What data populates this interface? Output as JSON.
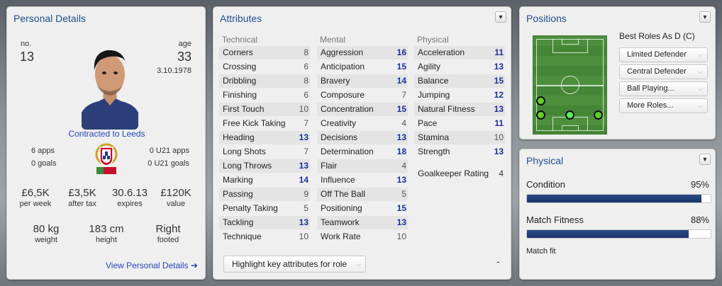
{
  "personal": {
    "title": "Personal Details",
    "no_label": "no.",
    "no_value": "13",
    "age_label": "age",
    "age_value": "33",
    "dob": "3.10.1978",
    "contract": "Contracted to Leeds",
    "apps": "6 apps",
    "goals": "0 goals",
    "u21_apps": "0 U21 apps",
    "u21_goals": "0 U21 goals",
    "stats": [
      {
        "value": "£6,5K",
        "label": "per week"
      },
      {
        "value": "£3,5K",
        "label": "after tax"
      },
      {
        "value": "30.6.13",
        "label": "expires"
      },
      {
        "value": "£120K",
        "label": "value"
      }
    ],
    "body": [
      {
        "value": "80 kg",
        "label": "weight"
      },
      {
        "value": "183 cm",
        "label": "height"
      },
      {
        "value": "Right",
        "label": "footed"
      }
    ],
    "view_link": "View Personal Details ➜"
  },
  "attributes": {
    "title": "Attributes",
    "technical_head": "Technical",
    "mental_head": "Mental",
    "physical_head": "Physical",
    "technical": [
      {
        "name": "Corners",
        "value": "8"
      },
      {
        "name": "Crossing",
        "value": "6"
      },
      {
        "name": "Dribbling",
        "value": "8"
      },
      {
        "name": "Finishing",
        "value": "6"
      },
      {
        "name": "First Touch",
        "value": "10"
      },
      {
        "name": "Free Kick Taking",
        "value": "7"
      },
      {
        "name": "Heading",
        "value": "13"
      },
      {
        "name": "Long Shots",
        "value": "7"
      },
      {
        "name": "Long Throws",
        "value": "13"
      },
      {
        "name": "Marking",
        "value": "14"
      },
      {
        "name": "Passing",
        "value": "9"
      },
      {
        "name": "Penalty Taking",
        "value": "5"
      },
      {
        "name": "Tackling",
        "value": "13"
      },
      {
        "name": "Technique",
        "value": "10"
      }
    ],
    "mental": [
      {
        "name": "Aggression",
        "value": "16"
      },
      {
        "name": "Anticipation",
        "value": "15"
      },
      {
        "name": "Bravery",
        "value": "14"
      },
      {
        "name": "Composure",
        "value": "7"
      },
      {
        "name": "Concentration",
        "value": "15"
      },
      {
        "name": "Creativity",
        "value": "4"
      },
      {
        "name": "Decisions",
        "value": "13"
      },
      {
        "name": "Determination",
        "value": "18"
      },
      {
        "name": "Flair",
        "value": "4"
      },
      {
        "name": "Influence",
        "value": "13"
      },
      {
        "name": "Off The Ball",
        "value": "5"
      },
      {
        "name": "Positioning",
        "value": "15"
      },
      {
        "name": "Teamwork",
        "value": "13"
      },
      {
        "name": "Work Rate",
        "value": "10"
      }
    ],
    "physical": [
      {
        "name": "Acceleration",
        "value": "11"
      },
      {
        "name": "Agility",
        "value": "13"
      },
      {
        "name": "Balance",
        "value": "15"
      },
      {
        "name": "Jumping",
        "value": "12"
      },
      {
        "name": "Natural Fitness",
        "value": "13"
      },
      {
        "name": "Pace",
        "value": "11"
      },
      {
        "name": "Stamina",
        "value": "10"
      },
      {
        "name": "Strength",
        "value": "13"
      }
    ],
    "goalkeeper": {
      "name": "Goalkeeper Rating",
      "value": "4"
    },
    "highlight_button": "Highlight key attributes for role",
    "dash": "-"
  },
  "positions": {
    "title": "Positions",
    "best_roles": "Best Roles As D (C)",
    "roles": [
      "Limited Defender",
      "Central Defender",
      "Ball Playing...",
      "More Roles..."
    ]
  },
  "physical": {
    "title": "Physical",
    "condition_label": "Condition",
    "condition_pct": "95%",
    "condition_value": 95,
    "fitness_label": "Match Fitness",
    "fitness_pct": "88%",
    "fitness_value": 88,
    "status": "Match fit"
  },
  "colors": {
    "title_blue": "#1f4f8c",
    "value_blue": "#1a2f9c",
    "value_grey": "#555555",
    "bar_fill": "#1e3b73",
    "pitch_green": "#4a8c3a"
  }
}
